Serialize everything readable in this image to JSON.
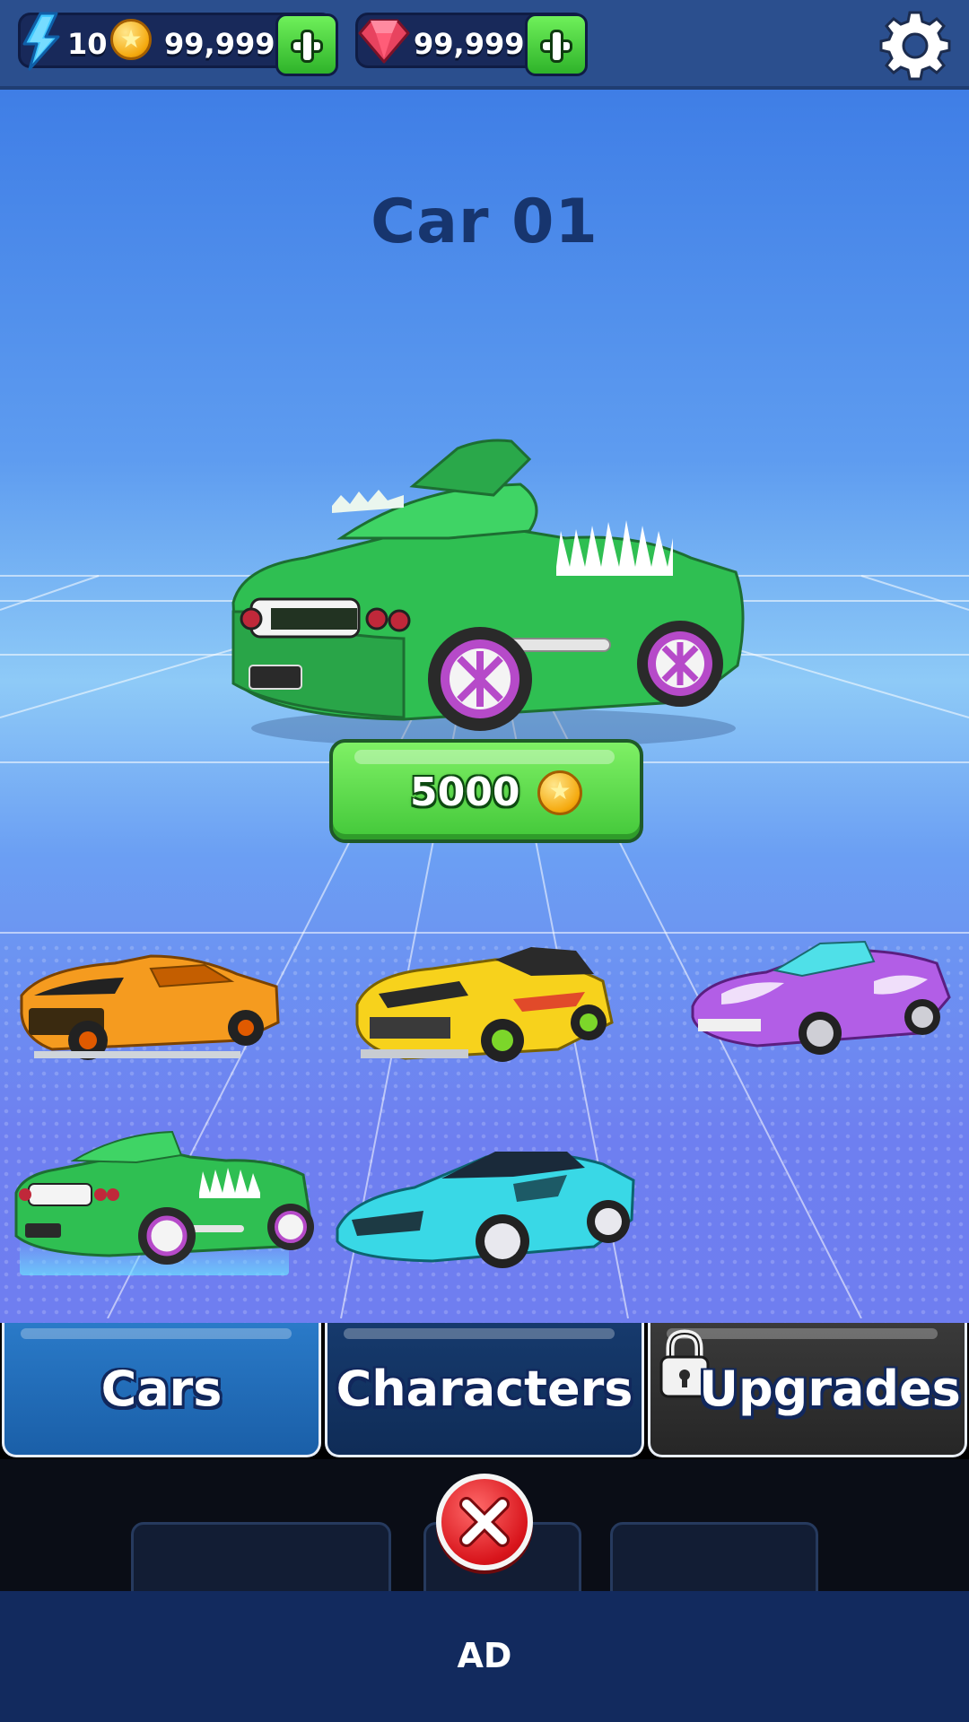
{
  "currency": {
    "energy": "10",
    "coins": "99,999",
    "gems": "99,999"
  },
  "showroom": {
    "title": "Car 01",
    "price": "5000"
  },
  "garage": {
    "cars": [
      {
        "color": "orange",
        "owned": true
      },
      {
        "color": "yellow",
        "owned": true
      },
      {
        "color": "purple",
        "owned": true
      },
      {
        "color": "green",
        "selected": true
      },
      {
        "color": "cyan",
        "owned": true
      }
    ]
  },
  "tabs": {
    "cars": "Cars",
    "characters": "Characters",
    "upgrades": "Upgrades"
  },
  "ad": {
    "label": "AD"
  },
  "colors": {
    "accent_green": "#43c83a",
    "topbar": "#2b4f8e",
    "ad_bar": "#122a5e",
    "close_red": "#d8141b"
  }
}
